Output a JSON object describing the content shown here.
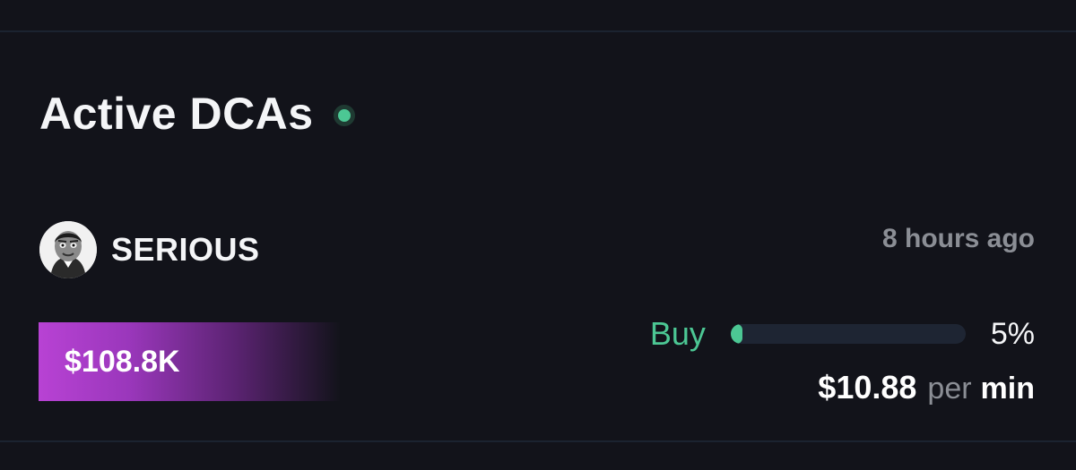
{
  "header": {
    "title": "Active DCAs",
    "status": "live"
  },
  "dca": {
    "token_name": "SERIOUS",
    "timestamp": "8 hours ago",
    "total_amount": "$108.8K",
    "side": "Buy",
    "progress_percent": 5,
    "progress_label": "5%",
    "rate_value": "$10.88",
    "rate_per": "per",
    "rate_unit": "min"
  },
  "colors": {
    "background": "#12131a",
    "accent_green": "#4cc794",
    "amount_gradient_start": "#b842d4",
    "muted_text": "#8b8e95",
    "track": "#1e2533"
  },
  "icons": {
    "avatar": "token-avatar-icon",
    "live": "live-status-dot-icon"
  }
}
